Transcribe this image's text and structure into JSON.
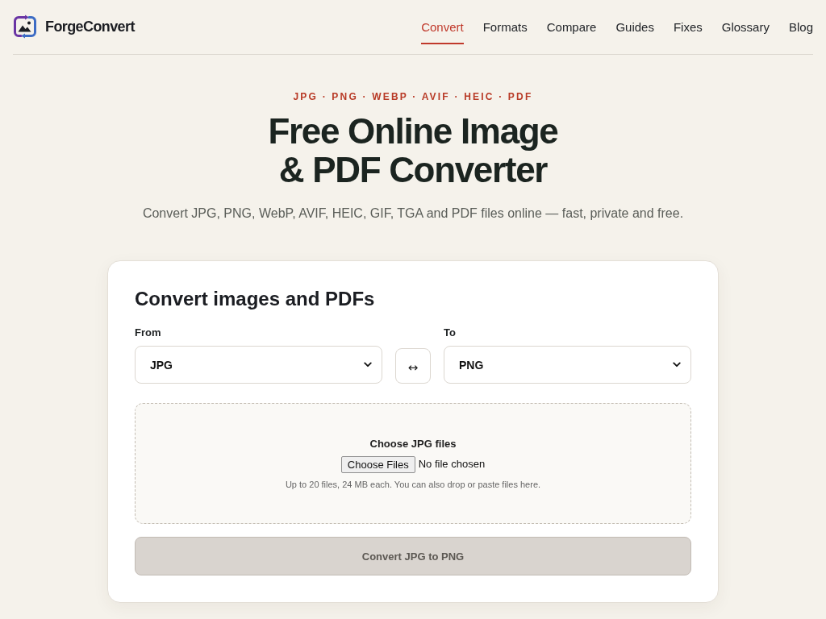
{
  "header": {
    "brand": "ForgeConvert",
    "nav": [
      {
        "label": "Convert",
        "selected": true
      },
      {
        "label": "Formats",
        "selected": false
      },
      {
        "label": "Compare",
        "selected": false
      },
      {
        "label": "Guides",
        "selected": false
      },
      {
        "label": "Fixes",
        "selected": false
      },
      {
        "label": "Glossary",
        "selected": false
      },
      {
        "label": "Blog",
        "selected": false
      }
    ]
  },
  "hero": {
    "eyebrow": "JPG · PNG · WEBP · AVIF · HEIC · PDF",
    "title": "Free Online Image & PDF Converter",
    "subtitle": "Convert JPG, PNG, WebP, AVIF, HEIC, GIF, TGA and PDF files online — fast, private and free."
  },
  "converter": {
    "title": "Convert images and PDFs",
    "from": {
      "label": "From",
      "value": "JPG"
    },
    "swap_button": {
      "label": "↔"
    },
    "to": {
      "label": "To",
      "value": "PNG"
    },
    "dropzone": {
      "title": "Choose JPG files",
      "file_button": "Choose Files",
      "file_status": "No file chosen",
      "hint": "Up to 20 files, 24 MB each. You can also drop or paste files here."
    },
    "convert_button": {
      "label": "Convert JPG to PNG",
      "disabled": true
    }
  }
}
